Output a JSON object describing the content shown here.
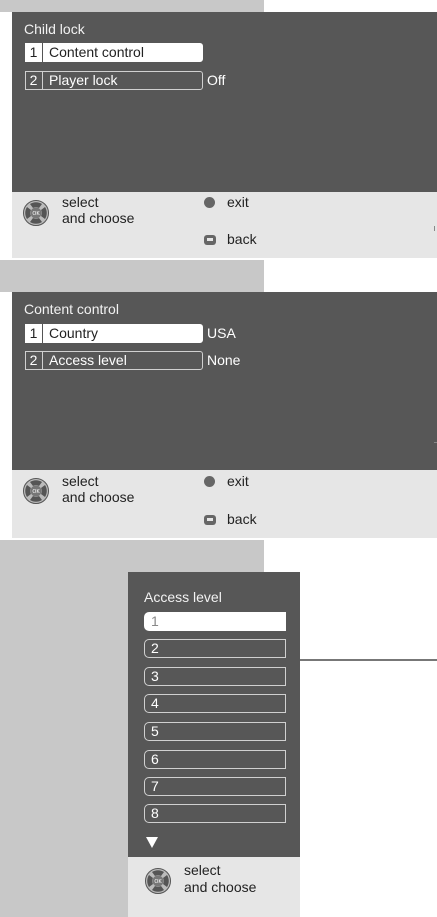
{
  "panel1": {
    "title": "Child lock",
    "rows": [
      {
        "num": "1",
        "label": "Content control",
        "value": ""
      },
      {
        "num": "2",
        "label": "Player lock",
        "value": "Off"
      }
    ]
  },
  "panel2": {
    "title": "Content control",
    "rows": [
      {
        "num": "1",
        "label": "Country",
        "value": "USA"
      },
      {
        "num": "2",
        "label": "Access level",
        "value": "None"
      }
    ]
  },
  "panel3": {
    "title": "Access level",
    "items": [
      "1",
      "2",
      "3",
      "4",
      "5",
      "6",
      "7",
      "8"
    ]
  },
  "footer": {
    "select": "select",
    "choose": "and choose",
    "exit": "exit",
    "back": "back"
  }
}
